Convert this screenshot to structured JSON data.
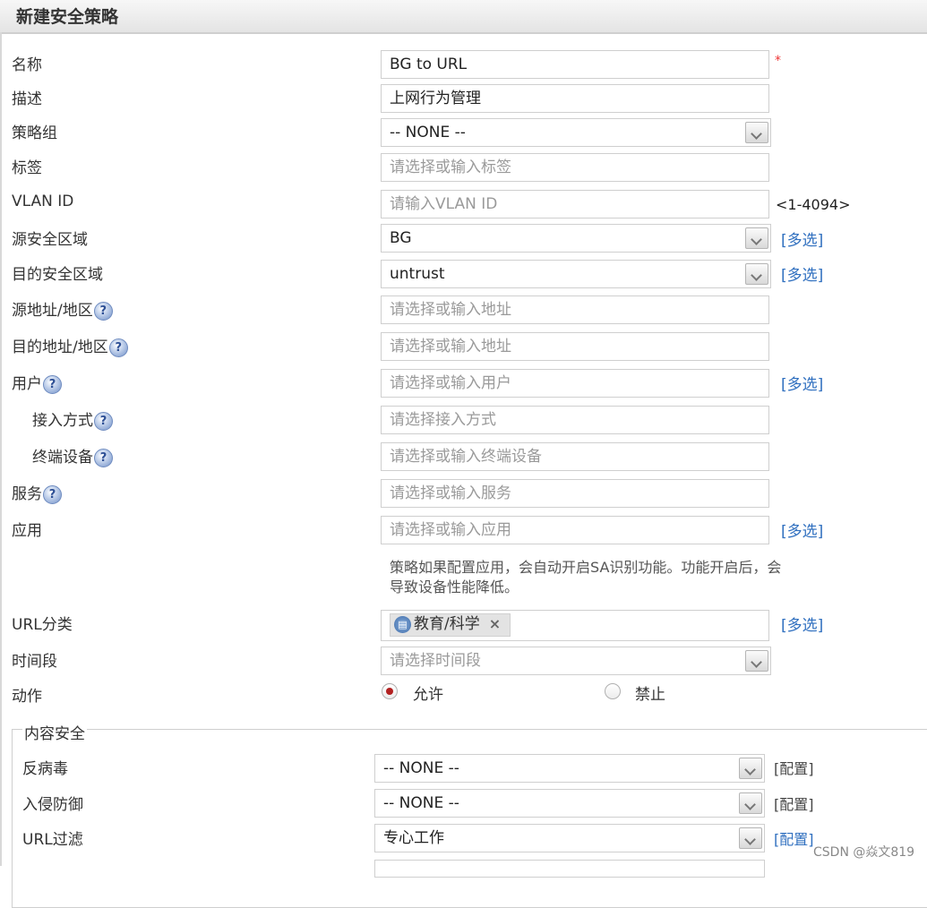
{
  "title": "新建安全策略",
  "required_mark": "*",
  "fields": {
    "name": {
      "label": "名称",
      "value": "BG to URL"
    },
    "desc": {
      "label": "描述",
      "value": "上网行为管理"
    },
    "group": {
      "label": "策略组",
      "value": "-- NONE --"
    },
    "tag": {
      "label": "标签",
      "placeholder": "请选择或输入标签"
    },
    "vlan": {
      "label": "VLAN ID",
      "placeholder": "请输入VLAN ID",
      "range": "<1-4094>"
    },
    "src_zone": {
      "label": "源安全区域",
      "value": "BG",
      "link": "[多选]"
    },
    "dst_zone": {
      "label": "目的安全区域",
      "value": "untrust",
      "link": "[多选]"
    },
    "src_addr": {
      "label": "源地址/地区",
      "placeholder": "请选择或输入地址"
    },
    "dst_addr": {
      "label": "目的地址/地区",
      "placeholder": "请选择或输入地址"
    },
    "user": {
      "label": "用户",
      "placeholder": "请选择或输入用户",
      "link": "[多选]"
    },
    "access": {
      "label": "接入方式",
      "placeholder": "请选择接入方式"
    },
    "terminal": {
      "label": "终端设备",
      "placeholder": "请选择或输入终端设备"
    },
    "service": {
      "label": "服务",
      "placeholder": "请选择或输入服务"
    },
    "app": {
      "label": "应用",
      "placeholder": "请选择或输入应用",
      "link": "[多选]",
      "note": "策略如果配置应用，会自动开启SA识别功能。功能开启后，会导致设备性能降低。"
    },
    "url_cat": {
      "label": "URL分类",
      "tag": "教育/科学",
      "link": "[多选]"
    },
    "time": {
      "label": "时间段",
      "placeholder": "请选择时间段"
    },
    "action": {
      "label": "动作",
      "allow": "允许",
      "deny": "禁止",
      "selected": "允许"
    }
  },
  "content_security": {
    "legend": "内容安全",
    "antivirus": {
      "label": "反病毒",
      "value": "-- NONE --",
      "cfg": "[配置]"
    },
    "ips": {
      "label": "入侵防御",
      "value": "-- NONE --",
      "cfg": "[配置]"
    },
    "url_filter": {
      "label": "URL过滤",
      "value": "专心工作",
      "cfg": "[配置]"
    }
  },
  "help_symbol": "?",
  "remove_symbol": "×",
  "watermark": "CSDN @焱文819",
  "colors": {
    "link": "#2f6fbf",
    "required": "#e33333",
    "radio_selected": "#b22020"
  }
}
